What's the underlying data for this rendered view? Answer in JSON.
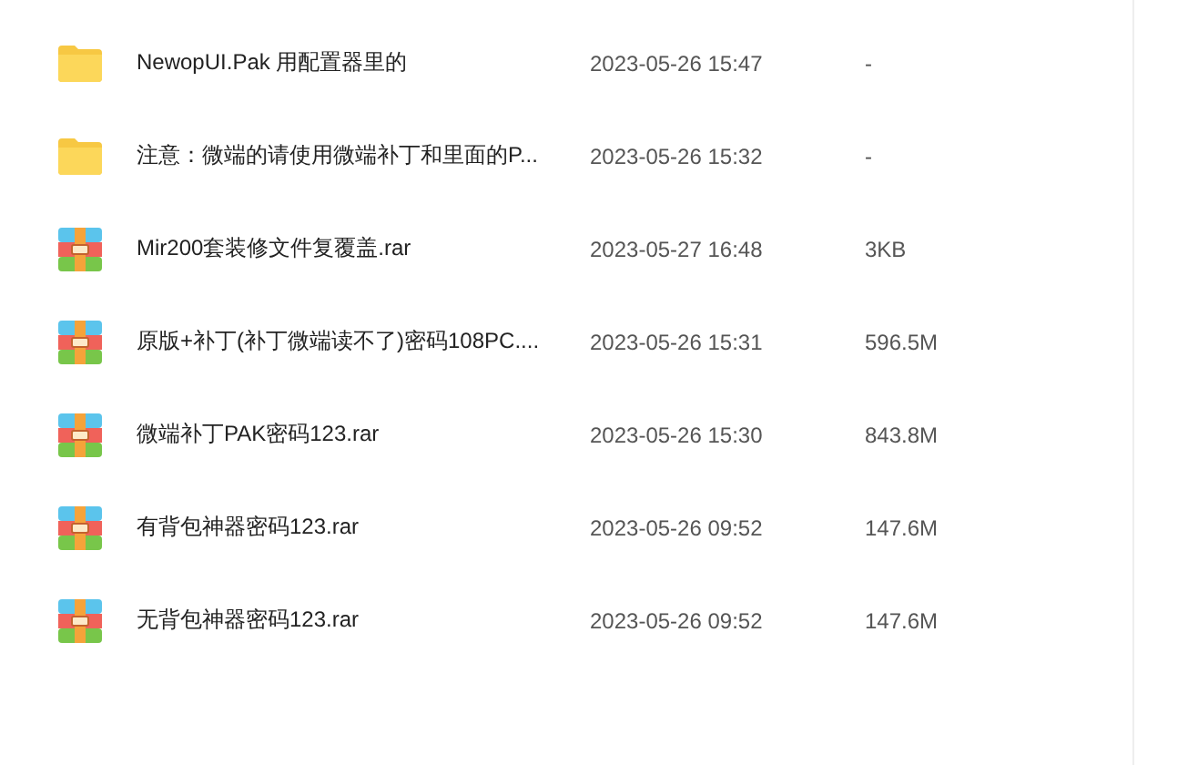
{
  "files": [
    {
      "kind": "folder",
      "name": "NewopUI.Pak 用配置器里的",
      "modified": "2023-05-26 15:47",
      "size": "-"
    },
    {
      "kind": "folder",
      "name": "注意：微端的请使用微端补丁和里面的P...",
      "modified": "2023-05-26 15:32",
      "size": "-"
    },
    {
      "kind": "archive",
      "name": "Mir200套装修文件复覆盖.rar",
      "modified": "2023-05-27 16:48",
      "size": "3KB"
    },
    {
      "kind": "archive",
      "name": "原版+补丁(补丁微端读不了)密码108PC....",
      "modified": "2023-05-26 15:31",
      "size": "596.5M"
    },
    {
      "kind": "archive",
      "name": "微端补丁PAK密码123.rar",
      "modified": "2023-05-26 15:30",
      "size": "843.8M"
    },
    {
      "kind": "archive",
      "name": "有背包神器密码123.rar",
      "modified": "2023-05-26 09:52",
      "size": "147.6M"
    },
    {
      "kind": "archive",
      "name": "无背包神器密码123.rar",
      "modified": "2023-05-26 09:52",
      "size": "147.6M"
    }
  ]
}
